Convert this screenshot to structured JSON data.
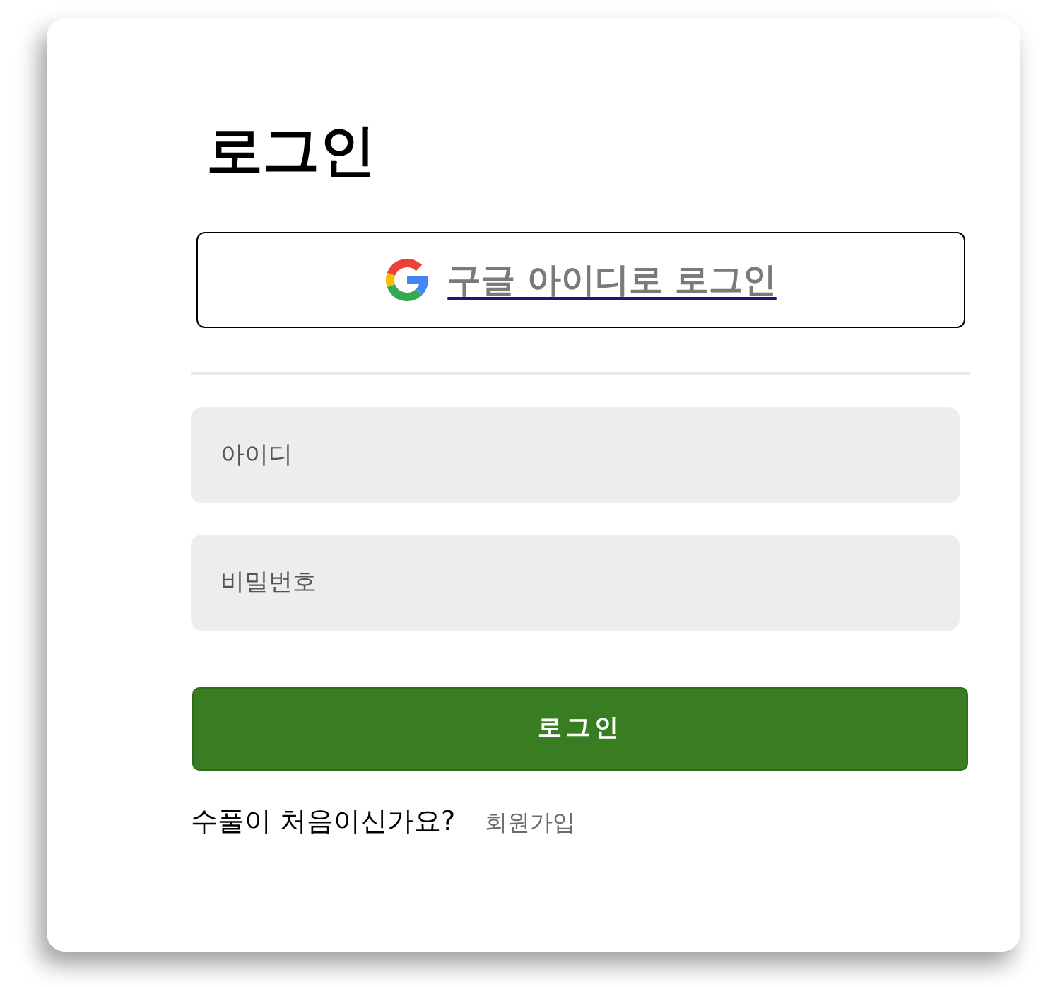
{
  "title": "로그인",
  "google_button": {
    "label": "구글 아이디로 로그인"
  },
  "fields": [
    {
      "placeholder": "아이디"
    },
    {
      "placeholder": "비밀번호"
    }
  ],
  "submit_button": {
    "label": "로그인"
  },
  "signup_prompt": {
    "text": "수풀이 처음이신가요?",
    "link": "회원가입"
  }
}
